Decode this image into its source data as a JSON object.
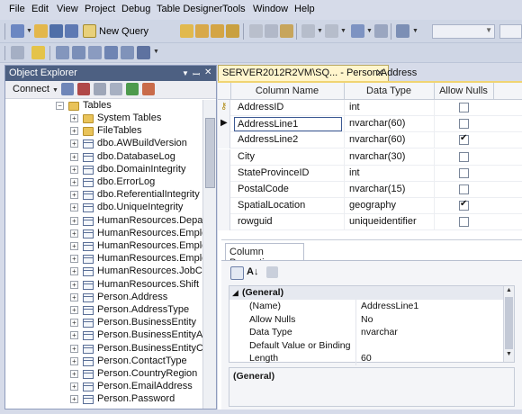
{
  "menu": {
    "file": "File",
    "edit": "Edit",
    "view": "View",
    "project": "Project",
    "debug": "Debug",
    "table_designer": "Table Designer",
    "tools": "Tools",
    "window": "Window",
    "help": "Help"
  },
  "toolbar": {
    "new_query": "New Query"
  },
  "object_explorer": {
    "title": "Object Explorer",
    "connect": "Connect",
    "tables_label": "Tables",
    "items": [
      {
        "label": "System Tables",
        "icon": "folder-icon"
      },
      {
        "label": "FileTables",
        "icon": "folder-icon"
      },
      {
        "label": "dbo.AWBuildVersion",
        "icon": "table-icon"
      },
      {
        "label": "dbo.DatabaseLog",
        "icon": "table-icon"
      },
      {
        "label": "dbo.DomainIntegrity",
        "icon": "table-icon"
      },
      {
        "label": "dbo.ErrorLog",
        "icon": "table-icon"
      },
      {
        "label": "dbo.ReferentialIntegrity",
        "icon": "table-icon"
      },
      {
        "label": "dbo.UniqueIntegrity",
        "icon": "table-icon"
      },
      {
        "label": "HumanResources.Departme",
        "icon": "table-icon"
      },
      {
        "label": "HumanResources.Employee",
        "icon": "table-icon"
      },
      {
        "label": "HumanResources.Employee",
        "icon": "table-icon"
      },
      {
        "label": "HumanResources.Employee",
        "icon": "table-icon"
      },
      {
        "label": "HumanResources.JobCandi",
        "icon": "table-icon"
      },
      {
        "label": "HumanResources.Shift",
        "icon": "table-icon"
      },
      {
        "label": "Person.Address",
        "icon": "table-icon"
      },
      {
        "label": "Person.AddressType",
        "icon": "table-icon"
      },
      {
        "label": "Person.BusinessEntity",
        "icon": "table-icon"
      },
      {
        "label": "Person.BusinessEntityAddre",
        "icon": "table-icon"
      },
      {
        "label": "Person.BusinessEntityConta",
        "icon": "table-icon"
      },
      {
        "label": "Person.ContactType",
        "icon": "table-icon"
      },
      {
        "label": "Person.CountryRegion",
        "icon": "table-icon"
      },
      {
        "label": "Person.EmailAddress",
        "icon": "table-icon"
      },
      {
        "label": "Person.Password",
        "icon": "table-icon"
      }
    ]
  },
  "designer": {
    "tab_title": "SERVER2012R2VM\\SQ... - Person.Address",
    "columns": {
      "name": "Column Name",
      "type": "Data Type",
      "nulls": "Allow Nulls"
    },
    "rows": [
      {
        "name": "AddressID",
        "type": "int",
        "allow_nulls": false,
        "key": true
      },
      {
        "name": "AddressLine1",
        "type": "nvarchar(60)",
        "allow_nulls": false,
        "current": true
      },
      {
        "name": "AddressLine2",
        "type": "nvarchar(60)",
        "allow_nulls": true
      },
      {
        "name": "City",
        "type": "nvarchar(30)",
        "allow_nulls": false
      },
      {
        "name": "StateProvinceID",
        "type": "int",
        "allow_nulls": false
      },
      {
        "name": "PostalCode",
        "type": "nvarchar(15)",
        "allow_nulls": false
      },
      {
        "name": "SpatialLocation",
        "type": "geography",
        "allow_nulls": true
      },
      {
        "name": "rowguid",
        "type": "uniqueidentifier",
        "allow_nulls": false
      }
    ]
  },
  "column_properties": {
    "tab": "Column Properties",
    "category": "(General)",
    "props": [
      {
        "name": "(Name)",
        "value": "AddressLine1"
      },
      {
        "name": "Allow Nulls",
        "value": "No"
      },
      {
        "name": "Data Type",
        "value": "nvarchar"
      },
      {
        "name": "Default Value or Binding",
        "value": ""
      },
      {
        "name": "Length",
        "value": "60"
      }
    ],
    "description_title": "(General)"
  }
}
